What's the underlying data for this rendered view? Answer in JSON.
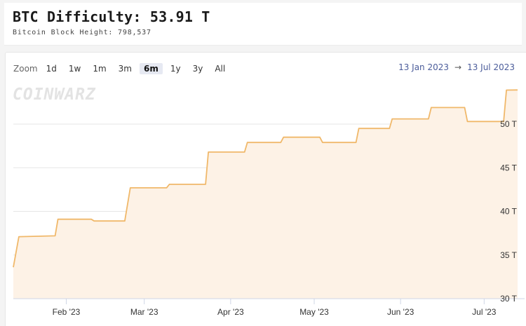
{
  "header": {
    "title": "BTC Difficulty: 53.91 T",
    "subtitle": "Bitcoin Block Height: 798,537"
  },
  "zoom": {
    "label": "Zoom",
    "buttons": [
      "1d",
      "1w",
      "1m",
      "3m",
      "6m",
      "1y",
      "3y",
      "All"
    ],
    "selected": "6m"
  },
  "range": {
    "start": "13 Jan 2023",
    "arrow": "→",
    "end": "13 Jul 2023"
  },
  "watermark": "COINWARZ",
  "colors": {
    "line": "#f0b86a",
    "fill": "#fdf2e6",
    "grid": "#e6e6e6",
    "axis": "#cfd6e6",
    "range_text": "#4b5c9a"
  },
  "chart_data": {
    "type": "area",
    "title": "BTC Difficulty: 53.91 T",
    "xlabel": "",
    "ylabel": "",
    "ylim": [
      30,
      54.5
    ],
    "xlim": [
      "2023-01-13",
      "2023-07-13"
    ],
    "grid": "horizontal",
    "legend": "none",
    "y_ticks": [
      30,
      35,
      40,
      45,
      50
    ],
    "y_tick_labels": [
      "30 T",
      "35 T",
      "40 T",
      "45 T",
      "50 T"
    ],
    "x_ticks": [
      {
        "date": "2023-02-01",
        "label": "Feb '23"
      },
      {
        "date": "2023-03-01",
        "label": "Mar '23"
      },
      {
        "date": "2023-04-01",
        "label": "Apr '23"
      },
      {
        "date": "2023-05-01",
        "label": "May '23"
      },
      {
        "date": "2023-06-01",
        "label": "Jun '23"
      },
      {
        "date": "2023-07-01",
        "label": "Jul '23"
      }
    ],
    "series": [
      {
        "values": [
          {
            "x": "2023-01-13",
            "y": 33.6
          },
          {
            "x": "2023-01-15",
            "y": 37.1
          },
          {
            "x": "2023-01-28",
            "y": 37.2
          },
          {
            "x": "2023-01-29",
            "y": 39.1
          },
          {
            "x": "2023-02-10",
            "y": 39.1
          },
          {
            "x": "2023-02-11",
            "y": 38.9
          },
          {
            "x": "2023-02-22",
            "y": 38.9
          },
          {
            "x": "2023-02-24",
            "y": 42.7
          },
          {
            "x": "2023-03-09",
            "y": 42.7
          },
          {
            "x": "2023-03-10",
            "y": 43.1
          },
          {
            "x": "2023-03-23",
            "y": 43.1
          },
          {
            "x": "2023-03-24",
            "y": 46.8
          },
          {
            "x": "2023-04-06",
            "y": 46.8
          },
          {
            "x": "2023-04-07",
            "y": 47.9
          },
          {
            "x": "2023-04-19",
            "y": 47.9
          },
          {
            "x": "2023-04-20",
            "y": 48.5
          },
          {
            "x": "2023-05-03",
            "y": 48.5
          },
          {
            "x": "2023-05-04",
            "y": 47.9
          },
          {
            "x": "2023-05-16",
            "y": 47.9
          },
          {
            "x": "2023-05-17",
            "y": 49.5
          },
          {
            "x": "2023-05-28",
            "y": 49.5
          },
          {
            "x": "2023-05-29",
            "y": 50.6
          },
          {
            "x": "2023-06-11",
            "y": 50.6
          },
          {
            "x": "2023-06-12",
            "y": 51.9
          },
          {
            "x": "2023-06-24",
            "y": 51.9
          },
          {
            "x": "2023-06-25",
            "y": 50.3
          },
          {
            "x": "2023-07-08",
            "y": 50.3
          },
          {
            "x": "2023-07-09",
            "y": 53.9
          },
          {
            "x": "2023-07-13",
            "y": 53.91
          }
        ]
      }
    ]
  }
}
